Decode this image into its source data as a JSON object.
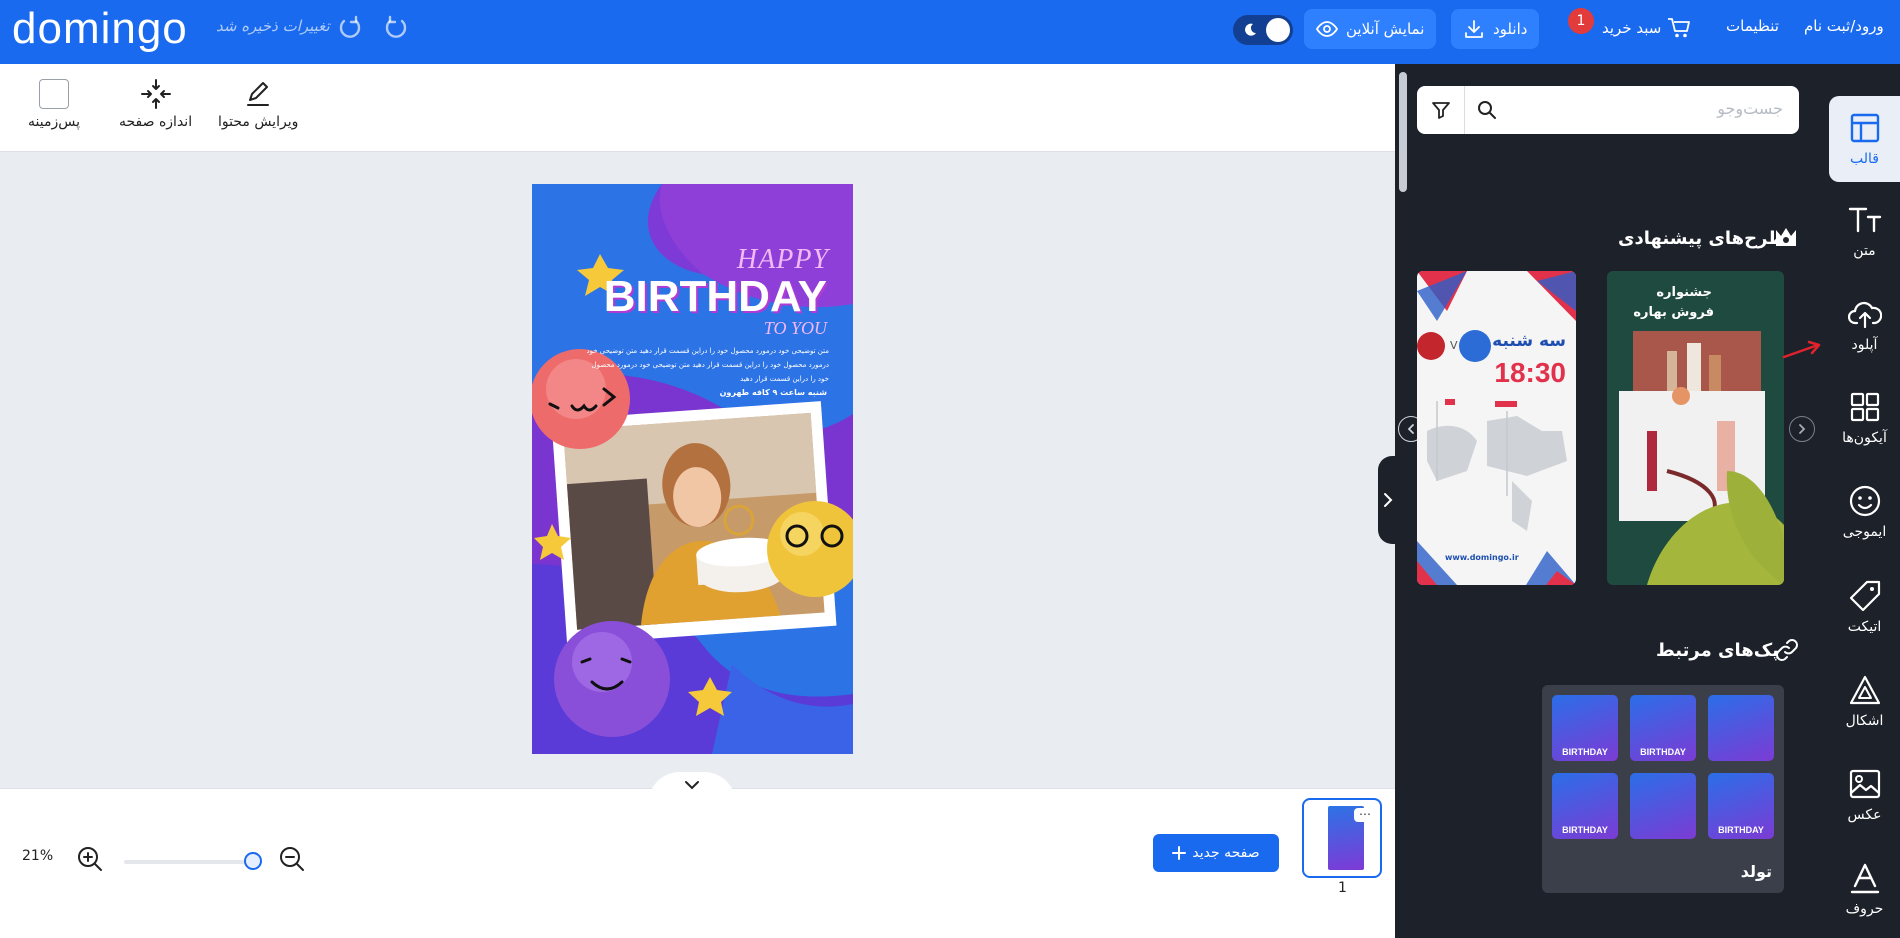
{
  "header": {
    "logo": "domingo",
    "save_status": "تغییرات ذخیره شد",
    "preview_label": "نمایش آنلاین",
    "download_label": "دانلود",
    "cart_label": "سبد خرید",
    "cart_count": "1",
    "settings_label": "تنظیمات",
    "login_label": "ورود/ثبت نام"
  },
  "toolbar": {
    "edit_content": "ویرایش محتوا",
    "page_size": "اندازه صفحه",
    "background": "پس‌زمینه"
  },
  "design": {
    "happy": "HAPPY",
    "birthday": "BIRTHDAY",
    "to_you": "TO YOU",
    "body_lines": [
      "متن توضیحی خود درمورد محصول خود را دراین قسمت قرار دهید متن توضیحی خود",
      "درمورد محصول خود را دراین قسمت قرار دهید متن توضیحی خود درمورد محصول",
      "خود را دراین قسمت قرار دهید"
    ],
    "footer": "شنبه ساعت ۹ کافه طهرون"
  },
  "bottom": {
    "zoom": "21%",
    "zoom_level": 0.95,
    "new_page": "صفحه جدید",
    "page_number": "1"
  },
  "panel": {
    "search_placeholder": "جست‌وجو",
    "suggested_title": "طرح‌های پیشنهادی",
    "related_title": "پک‌های مرتبط",
    "card1_line1": "جشنواره",
    "card1_line2": "فروش بهاره",
    "card2_day": "سه شنبه",
    "card2_time": "18:30",
    "card2_vs": "V",
    "card2_site": "www.domingo.ir",
    "pack_label": "تولد",
    "pack_tiles": [
      "BIRTHDAY",
      "BIRTHDAY",
      "",
      "BIRTHDAY",
      "",
      "BIRTHDAY"
    ]
  },
  "sidebar": {
    "items": [
      {
        "label": "قالب",
        "icon": "template-icon"
      },
      {
        "label": "متن",
        "icon": "text-icon"
      },
      {
        "label": "آپلود",
        "icon": "upload-icon"
      },
      {
        "label": "آیکون‌ها",
        "icon": "icons-grid-icon"
      },
      {
        "label": "ایموجی",
        "icon": "emoji-icon"
      },
      {
        "label": "اتیکت",
        "icon": "tag-icon"
      },
      {
        "label": "اشکال",
        "icon": "shapes-icon"
      },
      {
        "label": "عکس",
        "icon": "photo-icon"
      },
      {
        "label": "حروف",
        "icon": "letters-icon"
      }
    ]
  },
  "colors": {
    "brand": "#1a6af0",
    "panel_bg": "#1d2129",
    "design_purple": "#7e3ad6",
    "design_blue": "#2c73e6"
  }
}
